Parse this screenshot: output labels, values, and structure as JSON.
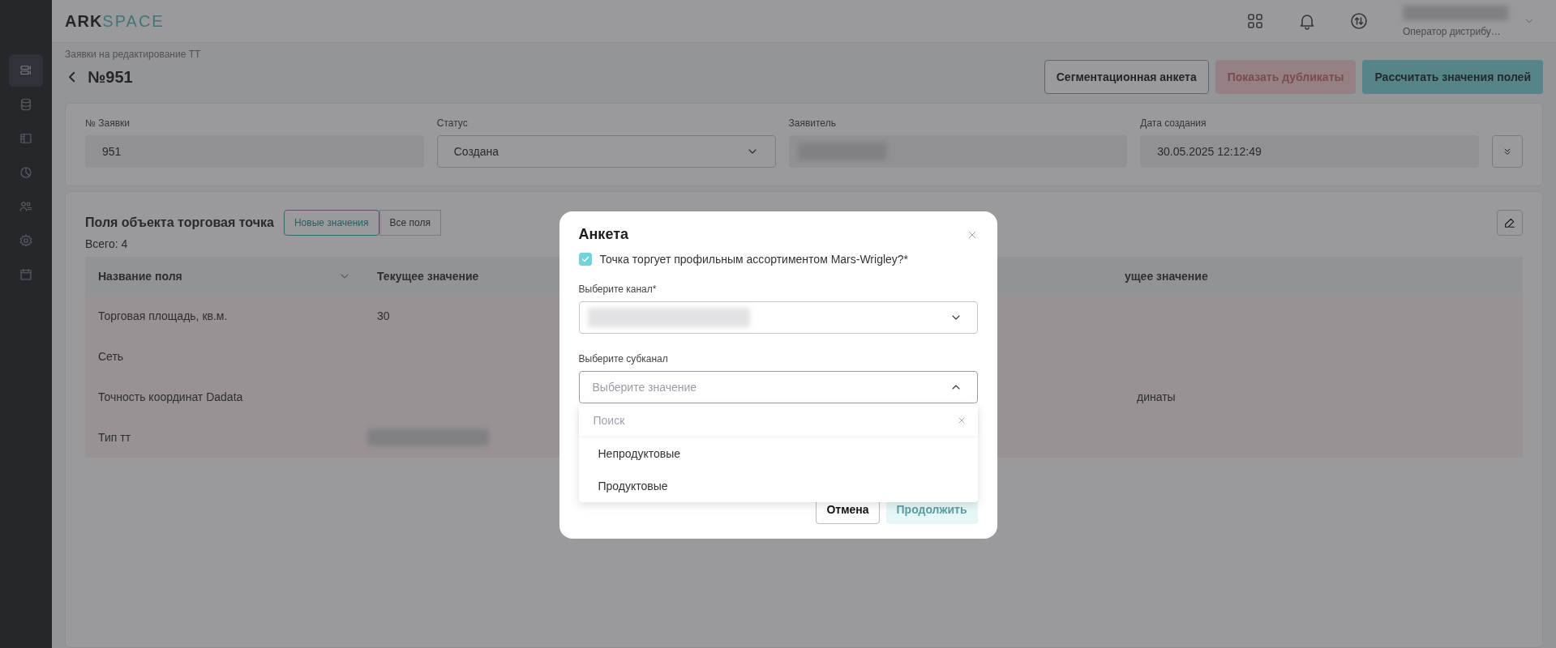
{
  "logo": {
    "part_1": "ARK",
    "part_2": "SPACE"
  },
  "sidebar": {
    "items": [
      {
        "selected": true
      },
      {
        "selected": false
      },
      {
        "selected": false
      },
      {
        "selected": false
      },
      {
        "selected": false
      },
      {
        "selected": false
      },
      {
        "selected": false
      }
    ]
  },
  "header": {
    "user_role": "Оператор дистрибу…"
  },
  "breadcrumb": "Заявки на редактирование ТТ",
  "title": "№951",
  "actions": [
    {
      "label": "Сегментационная анкета",
      "kind": "outline",
      "disabled": false
    },
    {
      "label": "Показать дубликаты",
      "kind": "danger",
      "disabled": true
    },
    {
      "label": "Рассчитать значения полей",
      "kind": "primary",
      "disabled": false
    }
  ],
  "request_fields": [
    {
      "label": "№ Заявки",
      "value": "951",
      "kind": "readonly"
    },
    {
      "label": "Статус",
      "value": "Создана",
      "kind": "select"
    },
    {
      "label": "Заявитель",
      "kind": "redacted"
    },
    {
      "label": "Дата создания",
      "value": "30.05.2025 12:12:49",
      "kind": "readonly"
    }
  ],
  "fields_panel": {
    "title": "Поля объекта торговая точка",
    "filters": [
      {
        "label": "Новые значения",
        "selected": true
      },
      {
        "label": "Все поля",
        "selected": false
      }
    ],
    "total": "Всего: 4",
    "columns": [
      "Название поля",
      "Текущее значение",
      "ущее значение"
    ],
    "rows": [
      {
        "name": "Торговая площадь, кв.м.",
        "current": "30",
        "redacted": false
      },
      {
        "name": "Сеть",
        "redacted": false
      },
      {
        "name": "Точность координат Dadata",
        "column_3": "динаты",
        "redacted": false
      },
      {
        "name": "Тип тт",
        "redacted": true
      }
    ]
  },
  "modal": {
    "title": "Анкета",
    "checkbox": {
      "label": "Точка торгует профильным ассортиментом Mars-Wrigley?*",
      "checked": true
    },
    "channel": {
      "label": "Выберите канал*"
    },
    "subchannel": {
      "label": "Выберите субканал",
      "placeholder": "Выберите значение",
      "expanded": true
    },
    "dropdown": {
      "search_placeholder": "Поиск",
      "options": [
        {
          "label": "Непродуктовые",
          "selected": false
        },
        {
          "label": "Продуктовые",
          "selected": false
        }
      ]
    },
    "buttons": [
      {
        "label": "Отмена",
        "kind": "secondary"
      },
      {
        "label": "Продолжить",
        "kind": "primary"
      }
    ]
  }
}
